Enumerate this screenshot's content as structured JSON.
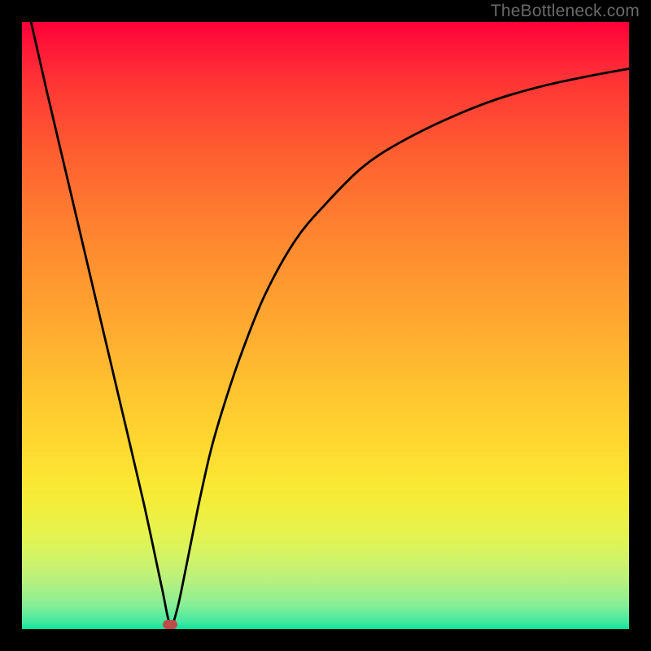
{
  "watermark": "TheBottleneck.com",
  "chart_data": {
    "type": "line",
    "title": "",
    "xlabel": "",
    "ylabel": "",
    "xlim": [
      0,
      100
    ],
    "ylim": [
      0,
      100
    ],
    "grid": false,
    "legend": false,
    "annotation_dot": {
      "x": 24.4,
      "y": 0.8,
      "color": "#bd4c49"
    },
    "curve_points": {
      "x": [
        1.5,
        4,
        8,
        12,
        16,
        20,
        23,
        24.4,
        25.5,
        27,
        29,
        31,
        33,
        36,
        40,
        45,
        50,
        56,
        62,
        70,
        78,
        86,
        94,
        100
      ],
      "y": [
        100,
        89,
        72,
        55,
        38,
        21,
        7,
        0.8,
        3,
        10,
        20,
        29,
        36,
        45,
        55,
        64,
        70,
        76,
        80,
        84,
        87.2,
        89.5,
        91.2,
        92.3
      ]
    },
    "background_gradient": {
      "direction": "vertical",
      "stops": [
        {
          "pos": 0.0,
          "color": "#ff0038"
        },
        {
          "pos": 0.3,
          "color": "#ff7730"
        },
        {
          "pos": 0.62,
          "color": "#ffc730"
        },
        {
          "pos": 0.8,
          "color": "#f1ee3c"
        },
        {
          "pos": 0.92,
          "color": "#b8f17e"
        },
        {
          "pos": 1.0,
          "color": "#08e49e"
        }
      ]
    }
  }
}
